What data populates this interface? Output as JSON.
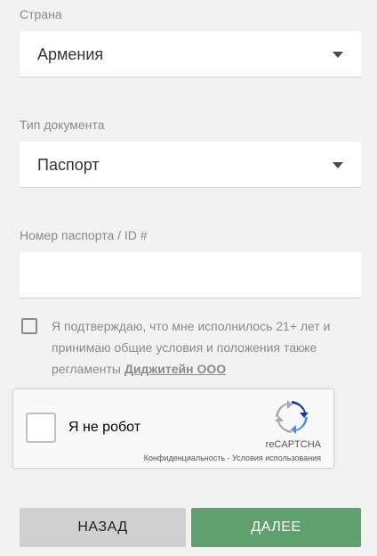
{
  "country": {
    "label": "Страна",
    "value": "Армения"
  },
  "document_type": {
    "label": "Тип документа",
    "value": "Паспорт"
  },
  "passport_number": {
    "label": "Номер паспорта / ID #",
    "value": ""
  },
  "terms": {
    "text": "Я подтверждаю, что мне исполнилось 21+ лет и принимаю общие условия и положения также регламенты ",
    "link_text": "Диджитейн ООО",
    "checked": false
  },
  "recaptcha": {
    "label": "Я не робот",
    "brand": "reCAPTCHA",
    "privacy": "Конфиденциальность",
    "separator": " - ",
    "terms": "Условия использования"
  },
  "buttons": {
    "back": "НАЗАД",
    "next": "ДАЛЕЕ"
  },
  "colors": {
    "primary": "#5fa06e",
    "secondary": "#d0d0d0",
    "background": "#f2f2f2"
  }
}
